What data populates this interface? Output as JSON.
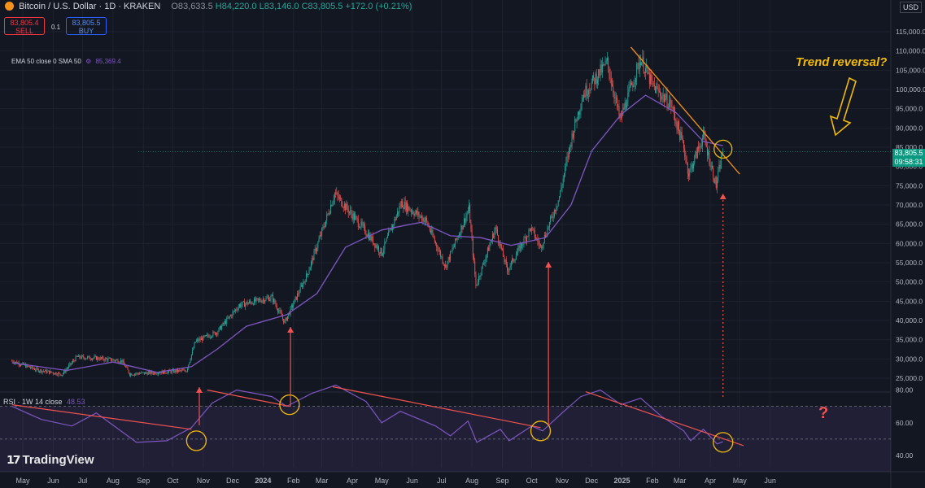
{
  "header": {
    "symbol": "Bitcoin / U.S. Dollar · 1D · KRAKEN",
    "open": "O83,633.5",
    "high": "H84,220.0",
    "low": "L83,146.0",
    "close": "C83,805.5",
    "change": "+172.0 (+0.21%)"
  },
  "trade": {
    "sell_price": "83,805.4",
    "sell_label": "SELL",
    "buy_price": "83,805.5",
    "buy_label": "BUY",
    "qty": "0.1"
  },
  "indicators": {
    "ema_label": "EMA 50 close 0 SMA 50",
    "ema_value": "85,369.4",
    "rsi_label": "RSI · 1W 14 close",
    "rsi_value": "48.53"
  },
  "currency": "USD",
  "last_price": {
    "price": "83,805.5",
    "countdown": "09:58:31"
  },
  "branding": "TradingView",
  "annotations": {
    "trend_text": "Trend reversal?",
    "question": "?"
  },
  "colors": {
    "up": "#26a69a",
    "down": "#ef5350",
    "ema": "#7e57c2",
    "trendline": "#f7931a",
    "circle": "#f0b90b"
  },
  "chart_data": {
    "type": "line",
    "x_ticks": [
      "May",
      "Jun",
      "Jul",
      "Aug",
      "Sep",
      "Oct",
      "Nov",
      "Dec",
      "2024",
      "Feb",
      "Mar",
      "Apr",
      "May",
      "Jun",
      "Jul",
      "Aug",
      "Sep",
      "Oct",
      "Nov",
      "Dec",
      "2025",
      "Feb",
      "Mar",
      "Apr",
      "May",
      "Jun"
    ],
    "y_ticks": [
      "115,000.0",
      "110,000.0",
      "105,000.0",
      "100,000.0",
      "95,000.0",
      "90,000.0",
      "85,000.0",
      "80,000.0",
      "75,000.0",
      "70,000.0",
      "65,000.0",
      "60,000.0",
      "55,000.0",
      "50,000.0",
      "45,000.0",
      "40,000.0",
      "35,000.0",
      "30,000.0",
      "25,000.0"
    ],
    "rsi_ticks": [
      "80.00",
      "60.00",
      "40.00"
    ],
    "ylim": [
      23000,
      117000
    ],
    "rsi_ylim": [
      32,
      88
    ],
    "series": [
      {
        "name": "BTCUSD",
        "points": [
          [
            "2023-04-20",
            29500
          ],
          [
            "2023-05-15",
            27200
          ],
          [
            "2023-06-10",
            26000
          ],
          [
            "2023-06-25",
            30500
          ],
          [
            "2023-07-15",
            30200
          ],
          [
            "2023-08-10",
            29500
          ],
          [
            "2023-08-18",
            26100
          ],
          [
            "2023-09-15",
            26500
          ],
          [
            "2023-10-15",
            27000
          ],
          [
            "2023-10-24",
            34500
          ],
          [
            "2023-11-15",
            37000
          ],
          [
            "2023-12-08",
            44000
          ],
          [
            "2024-01-10",
            46000
          ],
          [
            "2024-01-23",
            39500
          ],
          [
            "2024-02-15",
            52000
          ],
          [
            "2024-03-05",
            66000
          ],
          [
            "2024-03-14",
            73000
          ],
          [
            "2024-04-15",
            63000
          ],
          [
            "2024-05-01",
            57500
          ],
          [
            "2024-05-21",
            70500
          ],
          [
            "2024-06-15",
            66000
          ],
          [
            "2024-07-05",
            54000
          ],
          [
            "2024-07-29",
            69000
          ],
          [
            "2024-08-05",
            49000
          ],
          [
            "2024-08-25",
            64000
          ],
          [
            "2024-09-06",
            53000
          ],
          [
            "2024-09-30",
            64000
          ],
          [
            "2024-10-10",
            59000
          ],
          [
            "2024-10-29",
            72000
          ],
          [
            "2024-11-12",
            89000
          ],
          [
            "2024-11-22",
            98500
          ],
          [
            "2024-12-05",
            103000
          ],
          [
            "2024-12-17",
            107000
          ],
          [
            "2024-12-30",
            92000
          ],
          [
            "2025-01-20",
            108000
          ],
          [
            "2025-02-01",
            101000
          ],
          [
            "2025-02-20",
            96000
          ],
          [
            "2025-03-05",
            85000
          ],
          [
            "2025-03-10",
            78000
          ],
          [
            "2025-03-25",
            88000
          ],
          [
            "2025-04-07",
            75000
          ],
          [
            "2025-04-14",
            84500
          ]
        ]
      },
      {
        "name": "EMA 50",
        "points": [
          [
            "2023-04-20",
            29000
          ],
          [
            "2023-06-15",
            27000
          ],
          [
            "2023-08-01",
            29200
          ],
          [
            "2023-09-15",
            26500
          ],
          [
            "2023-10-20",
            28000
          ],
          [
            "2023-11-15",
            32500
          ],
          [
            "2023-12-15",
            38500
          ],
          [
            "2024-01-25",
            41500
          ],
          [
            "2024-02-25",
            47000
          ],
          [
            "2024-03-25",
            59000
          ],
          [
            "2024-05-01",
            63500
          ],
          [
            "2024-06-10",
            65500
          ],
          [
            "2024-07-10",
            62000
          ],
          [
            "2024-08-10",
            61500
          ],
          [
            "2024-09-10",
            59500
          ],
          [
            "2024-10-15",
            61500
          ],
          [
            "2024-11-10",
            70000
          ],
          [
            "2024-12-01",
            84000
          ],
          [
            "2024-12-31",
            93500
          ],
          [
            "2025-01-25",
            98500
          ],
          [
            "2025-02-25",
            94000
          ],
          [
            "2025-03-25",
            86500
          ],
          [
            "2025-04-14",
            85400
          ]
        ]
      },
      {
        "name": "RSI",
        "points": [
          [
            "2023-04-20",
            70
          ],
          [
            "2023-05-20",
            62
          ],
          [
            "2023-06-20",
            58
          ],
          [
            "2023-07-15",
            66
          ],
          [
            "2023-08-25",
            48
          ],
          [
            "2023-09-25",
            49
          ],
          [
            "2023-10-20",
            57
          ],
          [
            "2023-11-10",
            72
          ],
          [
            "2023-12-05",
            80
          ],
          [
            "2024-01-10",
            76
          ],
          [
            "2024-01-25",
            70
          ],
          [
            "2024-02-20",
            78
          ],
          [
            "2024-03-15",
            83
          ],
          [
            "2024-04-15",
            73
          ],
          [
            "2024-05-01",
            60
          ],
          [
            "2024-05-20",
            67
          ],
          [
            "2024-06-25",
            58
          ],
          [
            "2024-07-10",
            52
          ],
          [
            "2024-07-28",
            61
          ],
          [
            "2024-08-06",
            48
          ],
          [
            "2024-08-30",
            56
          ],
          [
            "2024-09-08",
            49
          ],
          [
            "2024-10-01",
            58
          ],
          [
            "2024-10-12",
            55
          ],
          [
            "2024-11-01",
            66
          ],
          [
            "2024-11-20",
            76
          ],
          [
            "2024-12-10",
            80
          ],
          [
            "2024-12-31",
            71
          ],
          [
            "2025-01-20",
            75
          ],
          [
            "2025-02-10",
            64
          ],
          [
            "2025-03-05",
            55
          ],
          [
            "2025-03-12",
            49
          ],
          [
            "2025-03-25",
            56
          ],
          [
            "2025-04-08",
            47
          ],
          [
            "2025-04-14",
            48.5
          ]
        ]
      }
    ]
  }
}
